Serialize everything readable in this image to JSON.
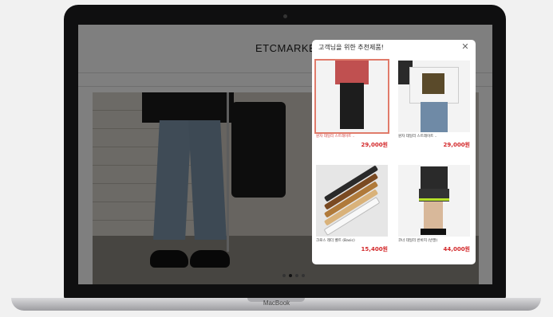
{
  "device": {
    "brand": "MacBook"
  },
  "site": {
    "logo": "ETCMARKET",
    "top_links_left": [
      "",
      "",
      ""
    ],
    "top_links_right": [
      "",
      "",
      "",
      "",
      ""
    ],
    "categories": [
      "",
      "",
      "",
      "",
      "",
      "",
      "",
      "",
      "",
      ""
    ],
    "slider": {
      "dots": 4,
      "active": 1
    }
  },
  "popup": {
    "title": "고객님을 위한 추천제품!",
    "close_icon": "close-icon",
    "products": [
      {
        "name": "원자 데일리 스트레이트 ..",
        "price": "29,000원",
        "selected": true
      },
      {
        "name": "원자 데일리 스트레이트 ..",
        "price": "29,000원",
        "selected": false
      },
      {
        "name": "크로스 레더 벨트 (Basic)",
        "price": "15,400원",
        "selected": false
      },
      {
        "name": "코너 데일리 반바지 (반팔)",
        "price": "44,000원",
        "selected": false
      }
    ]
  },
  "colors": {
    "price": "#d3282a",
    "selected_outline": "#e07b6a",
    "overlay": "rgba(0,0,0,0.5)"
  }
}
